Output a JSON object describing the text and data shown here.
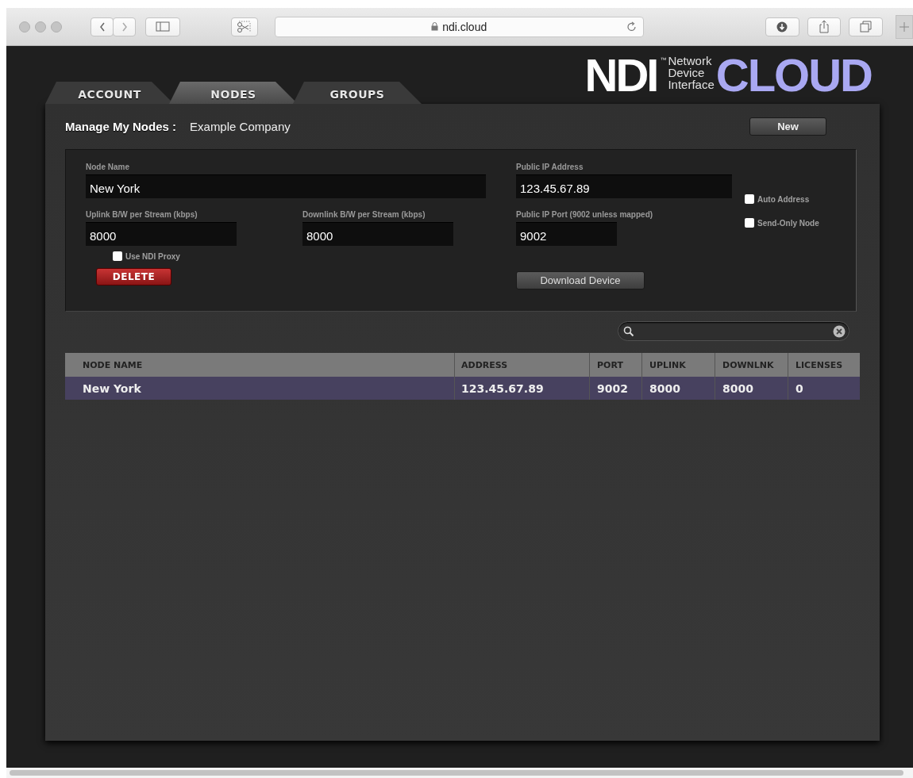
{
  "browser": {
    "url": "ndi.cloud"
  },
  "tabs": [
    {
      "label": "ACCOUNT",
      "selected": false
    },
    {
      "label": "NODES",
      "selected": true
    },
    {
      "label": "GROUPS",
      "selected": false
    }
  ],
  "logo": {
    "mark": "NDI",
    "trademark": "™",
    "tagline": [
      "Network",
      "Device",
      "Interface"
    ],
    "product": "CLOUD"
  },
  "header": {
    "title": "Manage My Nodes :",
    "company": "Example Company",
    "new_button": "New"
  },
  "form": {
    "node_name": {
      "label": "Node Name",
      "value": "New York"
    },
    "uplink": {
      "label": "Uplink B/W per Stream (kbps)",
      "value": "8000"
    },
    "downlink": {
      "label": "Downlink B/W per Stream (kbps)",
      "value": "8000"
    },
    "use_ndi_proxy": {
      "label": "Use NDI Proxy",
      "checked": false
    },
    "delete_button": "DELETE",
    "public_ip": {
      "label": "Public IP Address",
      "value": "123.45.67.89"
    },
    "public_port": {
      "label": "Public IP Port (9002 unless mapped)",
      "value": "9002"
    },
    "download_button": "Download Device",
    "auto_address": {
      "label": "Auto Address",
      "checked": false
    },
    "send_only_node": {
      "label": "Send-Only Node",
      "checked": false
    }
  },
  "table": {
    "columns": [
      "NODE NAME",
      "ADDRESS",
      "PORT",
      "UPLINK",
      "DOWNLNK",
      "LICENSES"
    ],
    "rows": [
      {
        "cells": [
          "New York",
          "123.45.67.89",
          "9002",
          "8000",
          "8000",
          "0"
        ],
        "selected": true
      }
    ]
  }
}
